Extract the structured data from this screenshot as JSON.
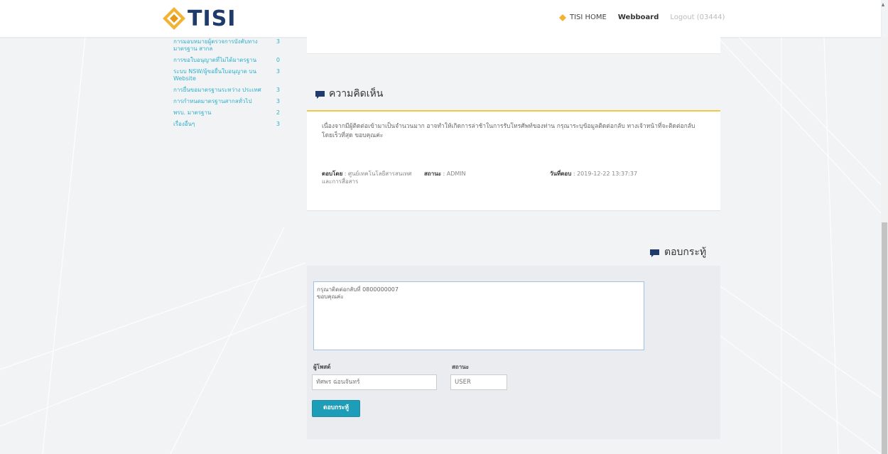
{
  "header": {
    "logo_text": "TISI",
    "nav": {
      "home": "TISI HOME",
      "webboard": "Webboard",
      "logout": "Logout (03444)"
    }
  },
  "sidebar": {
    "items": [
      {
        "label": "การมอบหมายผู้ตรวจการบังคับทางมาตรฐาน สากล",
        "count": "3"
      },
      {
        "label": "การขอใบอนุญาตที่ไม่ได้มาตรฐาน",
        "count": "0"
      },
      {
        "label": "ระบบ NSW/ผู้ขอยื่นใบอนุญาต บน Website",
        "count": "3"
      },
      {
        "label": "การยื่นขอมาตรฐานระหว่าง ประเทศ",
        "count": "3"
      },
      {
        "label": "การกำหนดมาตรฐานสากลทั่วไป",
        "count": "3"
      },
      {
        "label": "พรบ. มาตรฐาน",
        "count": "2"
      },
      {
        "label": "เรื่องอื่นๆ",
        "count": "3"
      }
    ]
  },
  "comment": {
    "heading": "ความคิดเห็น",
    "text": "เนื่องจากมีผู้ติดต่อเข้ามาเป็นจำนวนมาก อาจทำให้เกิดการล่าช้าในการรับโทรศัพท์ของท่าน กรุณาระบุข้อมูลติดต่อกลับ ทางเจ้าหน้าที่จะติดต่อกลับโดยเร็วที่สุด ขอบคุณค่ะ",
    "by_label": "ตอบโดย",
    "by_value": "ศูนย์เทคโนโลยีสารสนเทศ และการสื่อสาร",
    "status_label": "สถานะ",
    "status_value": "ADMIN",
    "date_label": "วันที่ตอบ",
    "date_value": "2019-12-22 13:37:37"
  },
  "reply": {
    "heading": "ตอบกระทู้",
    "message": "กรุณาติดต่อกลับที่ 0800000007\nขอบคุณค่ะ",
    "poster_label": "ผู้โพสต์",
    "poster_value": "ทัศพร ฉ่อนจันทร์",
    "status_label": "สถานะ",
    "status_value": "USER",
    "submit_label": "ตอบกระทู้"
  },
  "colors": {
    "accent": "#1e9db8",
    "gold": "#f2c744",
    "link": "#2fb0cd",
    "logo": "#1f3b6b"
  }
}
